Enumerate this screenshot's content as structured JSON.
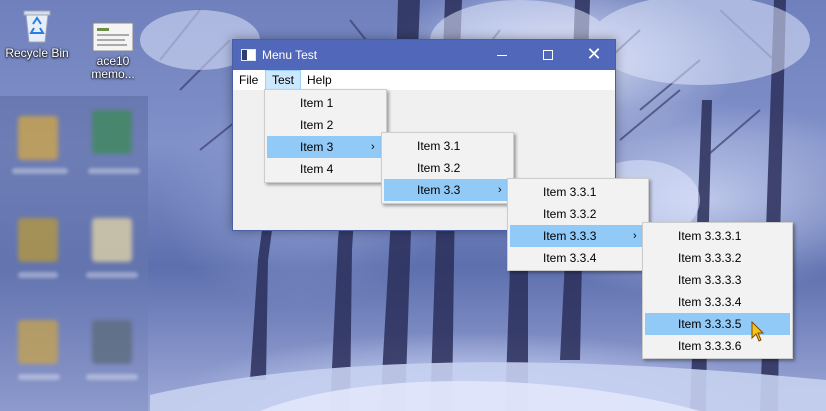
{
  "desktop": {
    "icons": [
      {
        "name": "recycle-bin",
        "label": "Recycle Bin"
      },
      {
        "name": "ace10-memo",
        "label": "ace10\nmemo..."
      }
    ]
  },
  "window": {
    "title": "Menu Test",
    "icon": "app-window-icon",
    "caption": {
      "minimize": "minimize-icon",
      "maximize": "maximize-icon",
      "close": "close-icon"
    }
  },
  "menubar": {
    "items": [
      "File",
      "Test",
      "Help"
    ],
    "active": "Test"
  },
  "menus": {
    "test": {
      "items": [
        "Item 1",
        "Item 2",
        "Item 3",
        "Item 4"
      ],
      "selected": "Item 3"
    },
    "item3": {
      "items": [
        "Item 3.1",
        "Item 3.2",
        "Item 3.3"
      ],
      "selected": "Item 3.3"
    },
    "item33": {
      "items": [
        "Item 3.3.1",
        "Item 3.3.2",
        "Item 3.3.3",
        "Item 3.3.4"
      ],
      "selected": "Item 3.3.3"
    },
    "item333": {
      "items": [
        "Item 3.3.3.1",
        "Item 3.3.3.2",
        "Item 3.3.3.3",
        "Item 3.3.3.4",
        "Item 3.3.3.5",
        "Item 3.3.3.6"
      ],
      "selected": "Item 3.3.3.5"
    },
    "submenu_arrow": "›"
  },
  "colors": {
    "titlebar": "#5167b9",
    "menu_highlight": "#91c9f7",
    "menubar_active": "#cce8ff",
    "cursor": "#f7c21b"
  }
}
